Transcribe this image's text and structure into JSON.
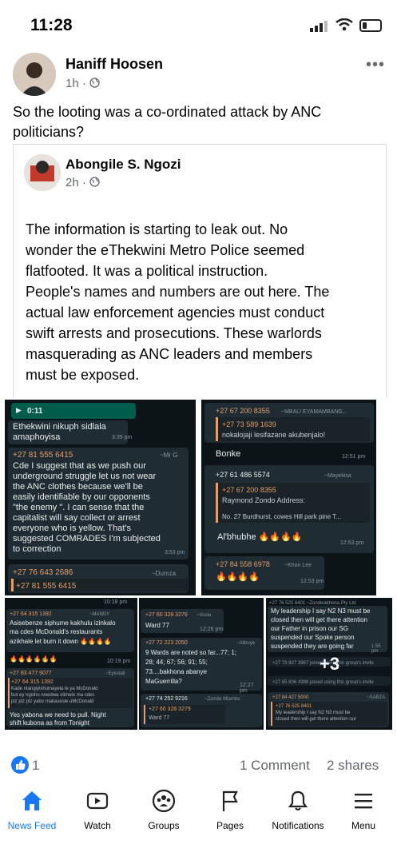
{
  "status_bar": {
    "time": "11:28"
  },
  "post": {
    "author": "Haniff Hoosen",
    "time": "1h ·",
    "text_line1": "So the looting was a co-ordinated attack by ANC",
    "text_line2": "politicians?"
  },
  "shared_post": {
    "author": "Abongile S. Ngozi",
    "time": "2h ·",
    "lines": [
      "The information is starting to leak out. No",
      "wonder the eThekwini Metro Police seemed",
      "flatfooted. It was a political instruction.",
      "People's names and numbers are out here. The",
      "actual law enforcement agencies must conduct",
      "swift arrests and prosecutions. These warlords",
      "masquerading as ANC leaders and members",
      "must be exposed."
    ]
  },
  "chat1": {
    "video_time": "0:11",
    "msg1_line1": "Ethekwini nikuph sidlala",
    "msg1_line2": "amaphoyisa",
    "msg1_time": "3:35 pm",
    "sender2": "+27 81 555 6415",
    "sender2_alias": "~Mr G",
    "msg2": [
      "Cde I suggest that as we push our",
      "underground struggle let us not wear",
      "the ANC clothes because we'll be",
      "easily identifiable by our opponents",
      "\"the enemy \". I can sense that the",
      "capitalist will say collect or arrest",
      "everyone who is yellow. That's",
      "suggested COMRADES I'm subjected",
      "to correction"
    ],
    "msg2_time": "3:53 pm",
    "sender3": "+27 76 643 2686",
    "sender3_alias": "~Dumza",
    "quoted": "+27 81 555 6415"
  },
  "chat2": {
    "sender1": "+27 67 200 8355",
    "sender1_alias": "~MBALI EYAMAMBANG...",
    "quoted1": "+27 73 589 1639",
    "quoted1_text": "nokalojaji lesifazane akubenjalo!",
    "msg1": "Bonke",
    "msg1_time": "12:51 pm",
    "sender2": "+27 61 486 5574",
    "sender2_alias": "~Mayekisa",
    "quoted2": "+27 67 200 8355",
    "quoted2_text": "Raymond Zondo Address:",
    "quoted2_addr": "No. 27 Burdhurst, cowes Hill park pine T...",
    "msg2": "Al'bhubhe 🔥🔥🔥🔥",
    "msg2_time": "12:53 pm",
    "sender3": "+27 84 558 6978",
    "sender3_alias": "~Khon Lee",
    "msg3": "🔥🔥🔥🔥",
    "msg3_time": "12:53 pm"
  },
  "chat3": {
    "top_time": "10:18 pm",
    "sender1": "+27 64 315 1392",
    "sender1_alias": "~MANDY",
    "msg1": [
      "Asisebenze siphume kakhulu izinkalo",
      "ma cdes McDonald's restaurants",
      "azikhale let burn it down 🔥🔥🔥🔥"
    ],
    "msg1b": "🔥🔥🔥🔥🔥🔥",
    "msg1_time": "10:19 pm",
    "sender2": "+27 83 477 9077",
    "sender2_alias": "~Eyestall",
    "quoted": "+27 64 315 1392",
    "quoted_text": [
      "Kade ntangiyishumayela le ya McDonald",
      "but ey ngisho nowdwa olimele ma cdes",
      "plz plz plz yabo makasesle uMcDonald"
    ],
    "msg2": [
      "Yes yabona we need to pull. Night",
      "shift kubona as from Tonight"
    ]
  },
  "chat4": {
    "sender1": "+27 60 328 3279",
    "sender1_alias": "~Vusie",
    "msg1": "Ward 77",
    "msg1_time": "12:26 pm",
    "sender2": "+27 72 223 2050",
    "sender2_alias": "~Alibuye",
    "msg2": [
      "9 Wards are noted so far...77; 1;",
      "28; 44; 67; 56; 91; 55;",
      "73....bakhona abanye",
      "MaGuerrilla?"
    ],
    "msg2_time": "12:27 pm",
    "sender3": "+27 74 252 9216",
    "sender3_alias": "~Zamile Mlambo",
    "quoted": "+27 60 328 3279",
    "quoted_text": "Ward 77"
  },
  "chat5": {
    "top": "+27 76 525 8401 ~Zondwakhona Pty Ltd",
    "msg1": [
      "My leadership I say N2 N3 must be",
      "closed then will get there attention",
      "our Father in prison our SG",
      "suspended our Spoke person",
      "suspended they are going far"
    ],
    "msg1_time": "1:55 pm",
    "sys1": "+27 73 927 3967 joined using this group's invite",
    "sys2": "+27 65 606 4388 joined using this group's invite",
    "sender2": "+27 84 427 5000",
    "sender2_alias": "~SABZA",
    "quoted": "+27 76 525 8401",
    "quoted_text": [
      "My leadership I say N2 N3 must be",
      "closed then will get there attention our"
    ],
    "more_label": "+3"
  },
  "engagement": {
    "likes": "1",
    "comments": "1 Comment",
    "shares": "2 shares"
  },
  "nav": {
    "news_feed": "News Feed",
    "watch": "Watch",
    "groups": "Groups",
    "pages": "Pages",
    "notifications": "Notifications",
    "menu": "Menu"
  },
  "colors": {
    "brand_blue": "#1877f2",
    "chat_bg": "#0d1418",
    "bubble_in": "#1f2c33",
    "bubble_out": "#005c4b"
  }
}
